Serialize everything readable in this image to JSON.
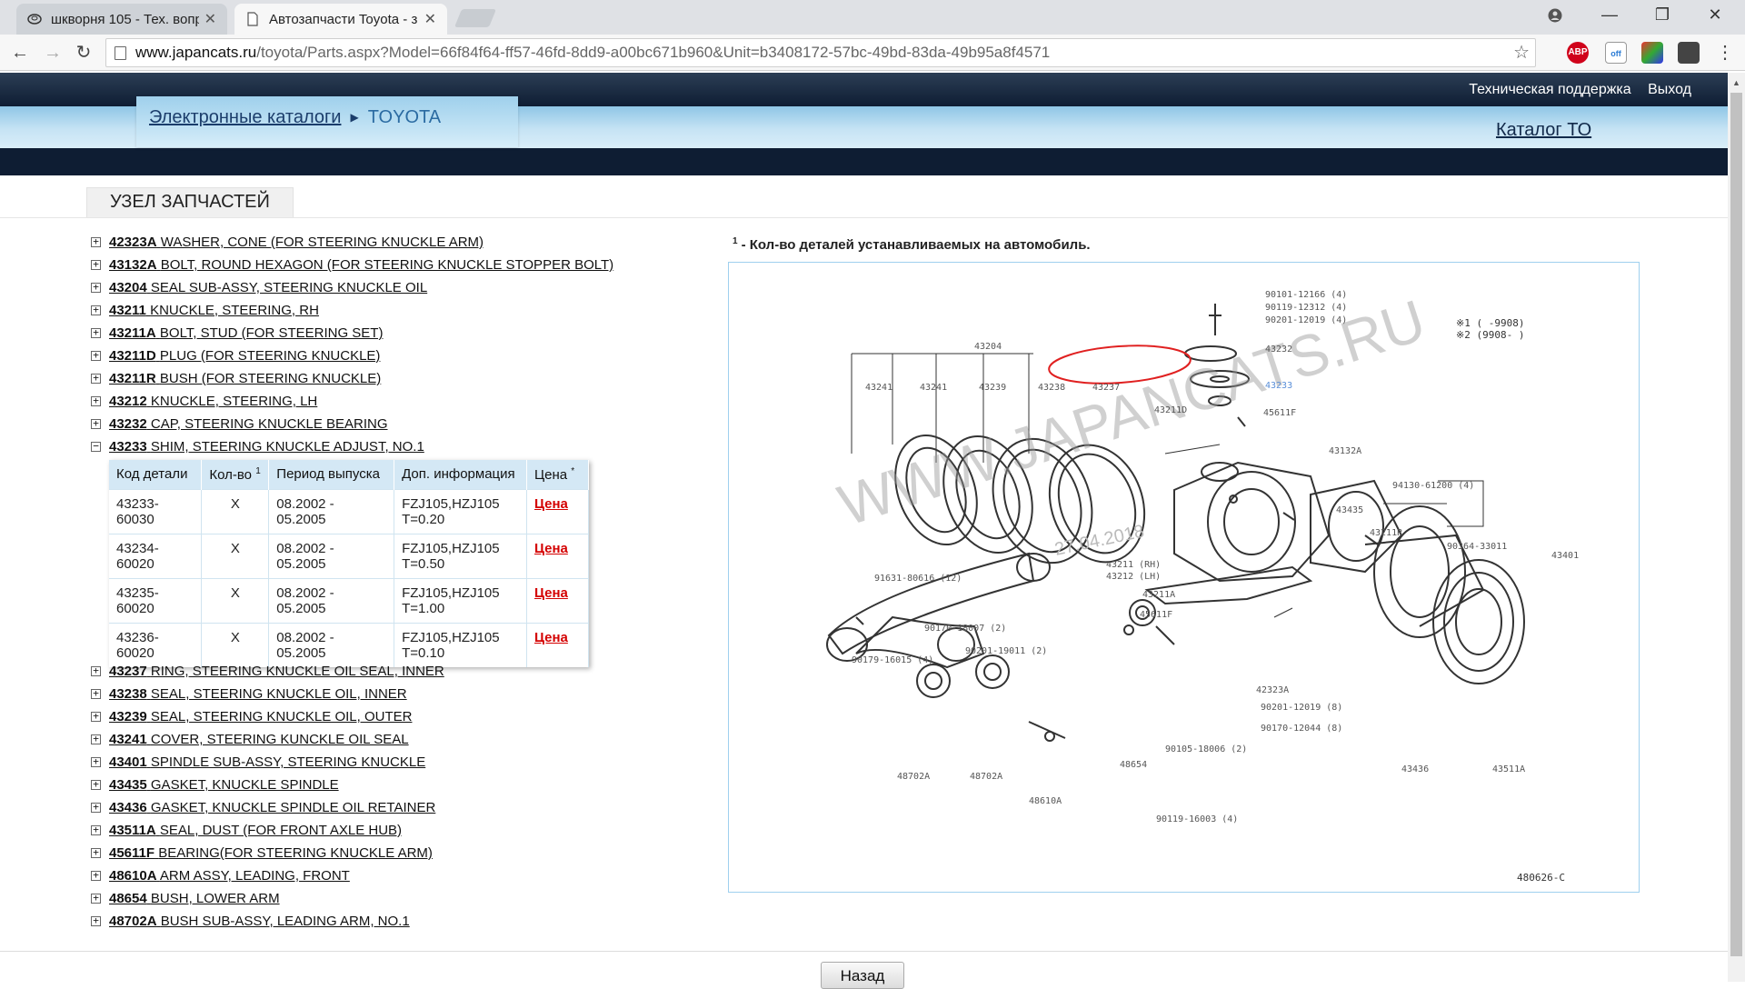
{
  "browser": {
    "tabs": [
      {
        "title": "шкворня 105 - Тех. вопр",
        "active": false
      },
      {
        "title": "Автозапчасти Toyota - з",
        "active": true
      }
    ],
    "url_host": "www.japancats.ru",
    "url_path": "/toyota/Parts.aspx?Model=66f84f64-ff57-46fd-8dd9-a00bc671b960&Unit=b3408172-57bc-49bd-83da-49b95a8f4571",
    "extensions": [
      "ABP",
      "off"
    ]
  },
  "header": {
    "support_link": "Техническая поддержка",
    "logout_link": "Выход",
    "breadcrumb_catalogs": "Электронные каталоги",
    "breadcrumb_current": "TOYOTA",
    "catalog_to": "Каталог ТО"
  },
  "section_title": "УЗЕЛ ЗАПЧАСТЕЙ",
  "parts_before": [
    {
      "code": "42323A",
      "name": "WASHER, CONE (FOR STEERING KNUCKLE ARM)"
    },
    {
      "code": "43132A",
      "name": "BOLT, ROUND HEXAGON (FOR STEERING KNUCKLE STOPPER BOLT)"
    },
    {
      "code": "43204",
      "name": "SEAL SUB-ASSY, STEERING KNUCKLE OIL"
    },
    {
      "code": "43211",
      "name": "KNUCKLE, STEERING, RH"
    },
    {
      "code": "43211A",
      "name": "BOLT, STUD (FOR STEERING SET)"
    },
    {
      "code": "43211D",
      "name": "PLUG (FOR STEERING KNUCKLE)"
    },
    {
      "code": "43211R",
      "name": "BUSH (FOR STEERING KNUCKLE)"
    },
    {
      "code": "43212",
      "name": "KNUCKLE, STEERING, LH"
    },
    {
      "code": "43232",
      "name": "CAP, STEERING KNUCKLE BEARING"
    },
    {
      "code": "43233",
      "name": "SHIM, STEERING KNUCKLE ADJUST, NO.1",
      "expanded": true
    }
  ],
  "detail_table": {
    "headers": [
      "Код детали",
      "Кол-во",
      "Период выпуска",
      "Доп. информация",
      "Цена"
    ],
    "qty_sup": "1",
    "price_sup": "*",
    "rows": [
      {
        "code": "43233-60030",
        "qty": "X",
        "period": "08.2002 - 05.2005",
        "info1": "FZJ105,HZJ105",
        "info2": "T=0.20",
        "price": "Цена"
      },
      {
        "code": "43234-60020",
        "qty": "X",
        "period": "08.2002 - 05.2005",
        "info1": "FZJ105,HZJ105",
        "info2": "T=0.50",
        "price": "Цена"
      },
      {
        "code": "43235-60020",
        "qty": "X",
        "period": "08.2002 - 05.2005",
        "info1": "FZJ105,HZJ105",
        "info2": "T=1.00",
        "price": "Цена"
      },
      {
        "code": "43236-60020",
        "qty": "X",
        "period": "08.2002 - 05.2005",
        "info1": "FZJ105,HZJ105",
        "info2": "T=0.10",
        "price": "Цена"
      }
    ]
  },
  "parts_after": [
    {
      "code": "43237",
      "name": "RING, STEERING KNUCKLE OIL SEAL, INNER"
    },
    {
      "code": "43238",
      "name": "SEAL, STEERING KNUCKLE OIL, INNER"
    },
    {
      "code": "43239",
      "name": "SEAL, STEERING KNUCKLE OIL, OUTER"
    },
    {
      "code": "43241",
      "name": "COVER, STEERING KUNCKLE OIL SEAL"
    },
    {
      "code": "43401",
      "name": "SPINDLE SUB-ASSY, STEERING KNUCKLE"
    },
    {
      "code": "43435",
      "name": "GASKET, KNUCKLE SPINDLE"
    },
    {
      "code": "43436",
      "name": "GASKET, KNUCKLE SPINDLE OIL RETAINER"
    },
    {
      "code": "43511A",
      "name": "SEAL, DUST (FOR FRONT AXLE HUB)"
    },
    {
      "code": "45611F",
      "name": "BEARING(FOR STEERING KNUCKLE ARM)"
    },
    {
      "code": "48610A",
      "name": "ARM ASSY, LEADING, FRONT"
    },
    {
      "code": "48654",
      "name": "BUSH, LOWER ARM"
    },
    {
      "code": "48702A",
      "name": "BUSH SUB-ASSY, LEADING ARM, NO.1"
    }
  ],
  "legend_sup": "1",
  "legend_text": "- Кол-во деталей устанавливаемых на автомобиль.",
  "diagram": {
    "watermark": "WWW.JAPANCATS.RU",
    "date_stamp": "27.04.2018",
    "figure_id": "480626-C",
    "labels": [
      "43204",
      "43241",
      "43241",
      "43239",
      "43238",
      "43237",
      "43232",
      "43233",
      "43211D",
      "45611F",
      "43132A",
      "94130-61200 (4)",
      "43435",
      "43211R",
      "90364-33011",
      "43401",
      "43211 (RH)",
      "43212 (LH)",
      "43211A",
      "45611F",
      "91631-80616 (12)",
      "90170-18007 (2)",
      "90201-19011 (2)",
      "90179-16015 (4)",
      "42323A",
      "90201-12019 (8)",
      "90170-12044 (8)",
      "90105-18006 (2)",
      "48702A",
      "48702A",
      "48654",
      "48610A",
      "90119-16003 (4)",
      "43436",
      "43511A",
      "90101-12166 (4)",
      "90119-12312 (4)",
      "90201-12019 (4)"
    ],
    "note1": "※1 (      -9908)",
    "note2": "※2 (9908-      )",
    "highlight_color": "#e02020"
  },
  "back_button": "Назад"
}
